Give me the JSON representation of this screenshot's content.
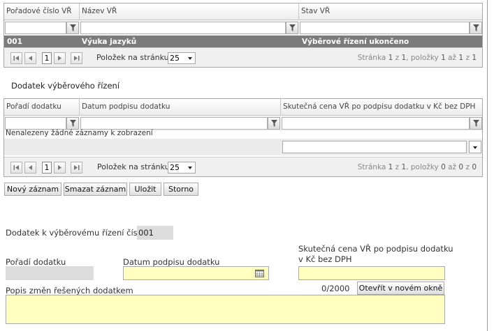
{
  "grid1": {
    "columns": [
      "Pořadové číslo VŘ",
      "Název VŘ",
      "Stav VŘ"
    ],
    "rows": [
      {
        "cislo": "001",
        "nazev": "Výuka jazyků",
        "stav": "Výběrové řízení ukončeno"
      }
    ],
    "pager": {
      "page": "1",
      "per_page_label": "Položek na stránku",
      "per_page": "25",
      "info_prefix": "Stránka",
      "info_page": "1",
      "info_of": "z",
      "info_pages": "1",
      "info_items": ", položky",
      "info_from": "1",
      "info_to_word": "až",
      "info_to": "1",
      "info_of2": "z",
      "info_total": "1"
    }
  },
  "section2": {
    "title": "Dodatek výběrového řízení"
  },
  "grid2": {
    "columns": [
      "Pořadí dodatku",
      "Datum podpisu dodatku",
      "Skutečná cena VŘ po podpisu dodatku v Kč bez DPH"
    ],
    "empty_text": "Nenalezeny žádné záznamy k zobrazení",
    "pager": {
      "page": "1",
      "per_page_label": "Položek na stránku",
      "per_page": "25",
      "info_prefix": "Stránka",
      "info_page": "1",
      "info_of": "z",
      "info_pages": "1",
      "info_items": ", položky",
      "info_from": "0",
      "info_to_word": "až",
      "info_to": "0",
      "info_of2": "z",
      "info_total": "0"
    }
  },
  "toolbar": {
    "new_label": "Nový záznam",
    "delete_label": "Smazat záznam",
    "save_label": "Uložit",
    "cancel_label": "Storno"
  },
  "form": {
    "dodatek_cislo_label": "Dodatek k výběrovému řízení číslo:",
    "dodatek_cislo_value": "001",
    "poradi_label": "Pořadí dodatku",
    "datum_label": "Datum podpisu dodatku",
    "cena_label_line1": "Skutečná cena VŘ po podpisu dodatku",
    "cena_label_line2": "v Kč bez DPH",
    "popis_label": "Popis změn řešených dodatkem",
    "popis_counter": "0/2000",
    "open_window_label": "Otevřít v novém okně"
  },
  "colors": {
    "selected_row": "#7b7b7b",
    "required_field": "#ffffc0",
    "readonly_field": "#dcdcdc"
  }
}
